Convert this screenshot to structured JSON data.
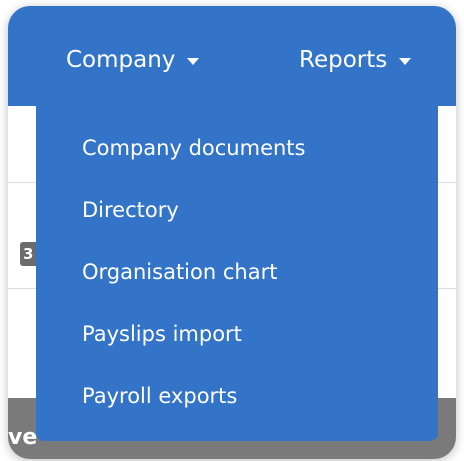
{
  "navbar": {
    "company_label": "Company",
    "reports_label": "Reports"
  },
  "background": {
    "badge_text": "3",
    "bottom_text": "ve"
  },
  "dropdown": {
    "items": [
      {
        "label": "Company documents"
      },
      {
        "label": "Directory"
      },
      {
        "label": "Organisation chart"
      },
      {
        "label": "Payslips import"
      },
      {
        "label": "Payroll exports"
      }
    ]
  },
  "colors": {
    "nav_background": "#3374c8",
    "text": "#ffffff",
    "bottom_bar": "#7a7a7a"
  }
}
